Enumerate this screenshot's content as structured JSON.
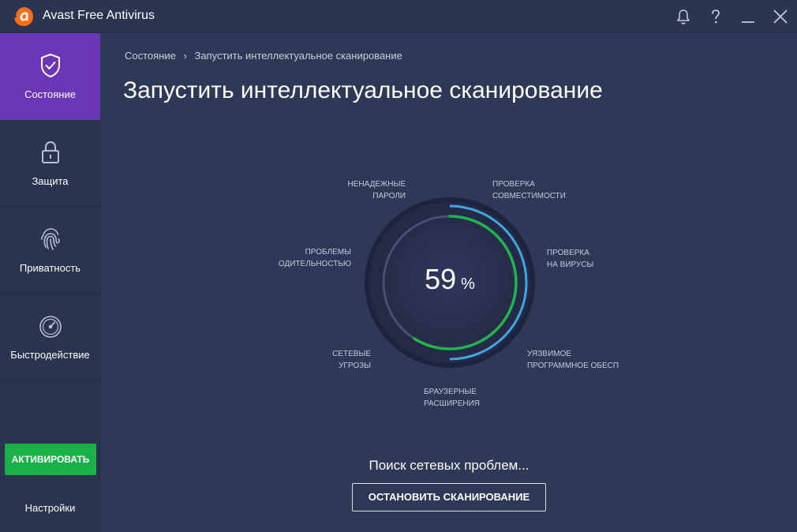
{
  "window": {
    "title": "Avast Free Antivirus",
    "brand_color": "#f96e1b"
  },
  "sidebar": {
    "items": [
      {
        "label": "Состояние",
        "icon": "shield-check-icon",
        "active": true
      },
      {
        "label": "Защита",
        "icon": "lock-icon",
        "active": false
      },
      {
        "label": "Приватность",
        "icon": "fingerprint-icon",
        "active": false
      },
      {
        "label": "Быстродействие",
        "icon": "speedometer-icon",
        "active": false
      }
    ],
    "activate_label": "АКТИВИРОВАТЬ",
    "settings_label": "Настройки",
    "active_color": "#6b37b8",
    "activate_color": "#19b148"
  },
  "breadcrumb": {
    "root": "Состояние",
    "separator": "›",
    "current": "Запустить интеллектуальное сканирование"
  },
  "page_title": "Запустить интеллектуальное сканирование",
  "scan": {
    "progress_value": "59",
    "progress_unit": "%",
    "progress_fraction": 0.59,
    "labels": {
      "passwords": [
        "НЕНАДЕЖНЫЕ",
        "ПАРОЛИ"
      ],
      "compatibility": [
        "ПРОВЕРКА",
        "СОВМЕСТИМОСТИ"
      ],
      "viruses": [
        "ПРОВЕРКА",
        "НА ВИРУСЫ"
      ],
      "software": [
        "УЯЗВИМОЕ",
        "ПРОГРАММНОЕ ОБЕСП"
      ],
      "browser": [
        "БРАУЗЕРНЫЕ",
        "РАСШИРЕНИЯ"
      ],
      "network": [
        "СЕТЕВЫЕ",
        "УГРОЗЫ"
      ],
      "performance": [
        "ПРОБЛЕМЫ",
        "ОДИТЕЛЬНОСТЬЮ"
      ]
    },
    "status_text": "Поиск сетевых проблем...",
    "stop_label": "ОСТАНОВИТЬ СКАНИРОВАНИЕ",
    "progress_color": "#1fb44e",
    "scan_color": "#3fa6e0"
  }
}
